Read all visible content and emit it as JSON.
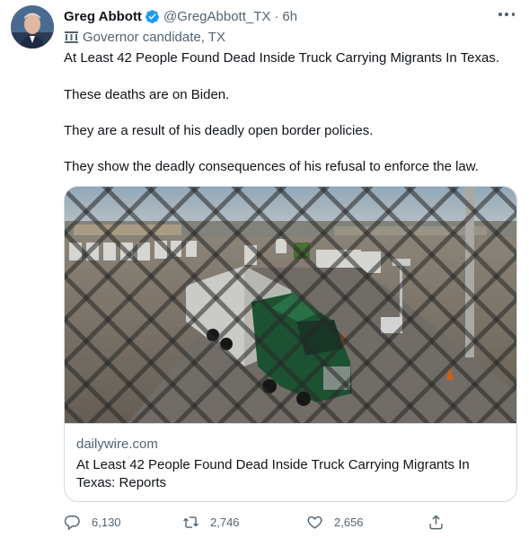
{
  "tweet": {
    "author_name": "Greg Abbott",
    "handle": "@GregAbbott_TX",
    "separator": "·",
    "time": "6h",
    "label": "Governor candidate, TX",
    "lines": [
      "At Least 42 People Found Dead Inside Truck Carrying Migrants In Texas.",
      "These deaths are on Biden.",
      "They are a result of his deadly open border policies.",
      "They show the deadly consequences of his refusal to enforce the law."
    ]
  },
  "card": {
    "domain": "dailywire.com",
    "title": "At Least 42 People Found Dead Inside Truck Carrying Migrants In Texas: Reports",
    "image_subject": "green semi-truck seen through chain-link fence at border crossing"
  },
  "actions": {
    "replies": "6,130",
    "retweets": "2,746",
    "likes": "2,656"
  },
  "icons": {
    "verified": "verified-badge-icon",
    "label": "government-building-icon",
    "more": "more-options-icon",
    "reply": "reply-icon",
    "retweet": "retweet-icon",
    "like": "heart-icon",
    "share": "share-icon"
  },
  "colors": {
    "verified_blue": "#1d9bf0",
    "secondary_text": "#536471",
    "primary_text": "#0f1419",
    "border": "#cfd9de"
  }
}
